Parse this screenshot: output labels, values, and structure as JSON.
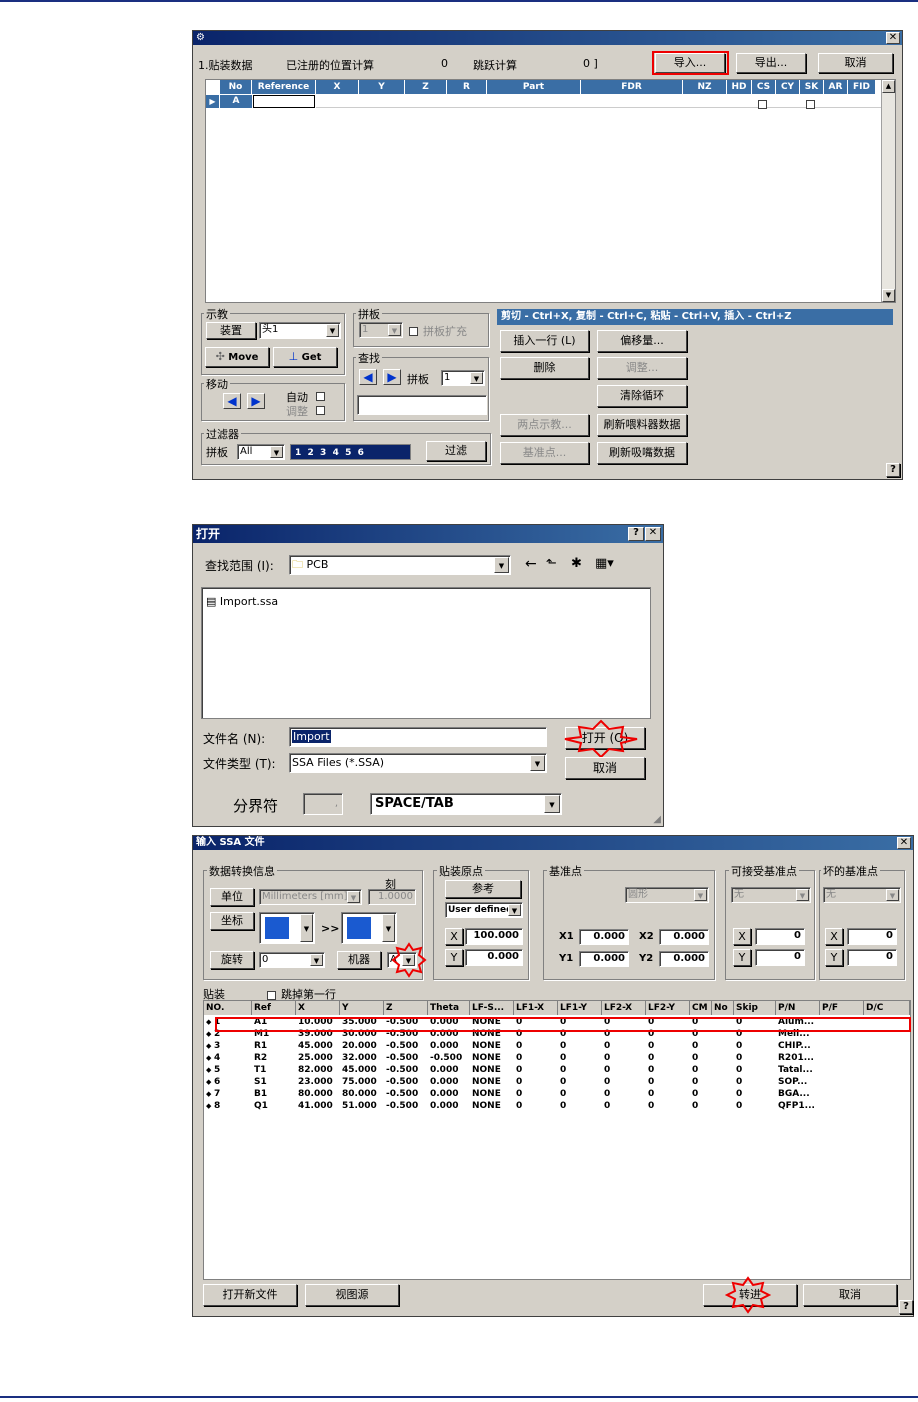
{
  "w1": {
    "title_icon": "app-icon",
    "info_label": "1.贴装数据",
    "registered_label": "已注册的位置计算",
    "registered_value": "0",
    "skip_label": "跳跃计算",
    "skip_value": "0 ]",
    "import_btn": "导入...",
    "export_btn": "导出...",
    "cancel_btn": "取消",
    "columns": [
      "No",
      "Reference",
      "X",
      "Y",
      "Z",
      "R",
      "Part",
      "FDR",
      "NZ",
      "HD",
      "CS",
      "CY",
      "SK",
      "AR",
      "FID"
    ],
    "row_no": "A",
    "teach_label": "示教",
    "mount_btn": "装置",
    "head_value": "头1",
    "move_btn": "Move",
    "get_btn": "Get",
    "move_label": "移动",
    "auto_label": "自动",
    "adjust_label": "调整",
    "panel_label": "拼板",
    "panel_value": "1",
    "panel_expand": "拼板扩充",
    "find_label": "查找",
    "find_panel_label": "拼板",
    "find_panel_value": "1",
    "filter_label": "过滤器",
    "filter_panel_label": "拼板",
    "filter_panel_value": "All",
    "filter_numbers": "1  2  3  4  5  6",
    "filter_btn": "过滤",
    "shortcut_text": "剪切 - Ctrl+X, 复制 - Ctrl+C, 粘贴 - Ctrl+V, 插入 - Ctrl+Z",
    "insert_row_btn": "插入一行 (L)",
    "offset_btn": "偏移量...",
    "delete_btn": "删除",
    "adjust_btn": "调整...",
    "clear_loop_btn": "清除循环",
    "two_point_btn": "两点示教...",
    "refresh_feeder_btn": "刷新喂料器数据",
    "fiducial_btn": "基准点...",
    "refresh_nozzle_btn": "刷新吸嘴数据",
    "help": "?"
  },
  "w2": {
    "title": "打开",
    "lookin_label": "查找范围 (I):",
    "lookin_value": "PCB",
    "file_item": "Import.ssa",
    "filename_label": "文件名 (N):",
    "filename_value": "Import",
    "filetype_label": "文件类型 (T):",
    "filetype_value": "SSA Files (*.SSA)",
    "open_btn": "打开 (O)",
    "cancel_btn": "取消",
    "separator_label": "分界符",
    "separator_value": ",",
    "delimiter_value": "SPACE/TAB"
  },
  "w3": {
    "title": "输入 SSA 文件",
    "conv_label": "数据转换信息",
    "unit_label": "单位",
    "unit_value": "Millimeters [mm]",
    "scale_label": "刻",
    "scale_value": "1.0000",
    "coord_label": "坐标",
    "rotate_label": "旋转",
    "rotate_value": "0",
    "machine_label": "机器",
    "machine_value": "A",
    "origin_label": "贴装原点",
    "ref_btn": "参考",
    "origin_mode": "User defined",
    "origin_x_label": "X",
    "origin_x": "100.000",
    "origin_y_label": "Y",
    "origin_y": "0.000",
    "fid_label": "基准点",
    "fid_shape": "圆形",
    "x1_label": "X1",
    "x1": "0.000",
    "x2_label": "X2",
    "x2": "0.000",
    "y1_label": "Y1",
    "y1": "0.000",
    "y2_label": "Y2",
    "y2": "0.000",
    "acc_fid_label": "可接受基准点",
    "acc_fid_value": "无",
    "acc_x_label": "X",
    "acc_x": "0",
    "acc_y_label": "Y",
    "acc_y": "0",
    "bad_fid_label": "坏的基准点",
    "bad_fid_value": "无",
    "bad_x_label": "X",
    "bad_x": "0",
    "bad_y_label": "Y",
    "bad_y": "0",
    "mount_label": "贴装",
    "skip_first_label": "跳掉第一行",
    "columns": [
      "NO.",
      "Ref",
      "X",
      "Y",
      "Z",
      "Theta",
      "LF-S...",
      "LF1-X",
      "LF1-Y",
      "LF2-X",
      "LF2-Y",
      "CM",
      "No",
      "Skip",
      "P/N",
      "P/F",
      "D/C"
    ],
    "rows": [
      [
        "1",
        "A1",
        "10.000",
        "35.000",
        "-0.500",
        "0.000",
        "NONE",
        "0",
        "0",
        "0",
        "0",
        "0",
        "0",
        "Alum..."
      ],
      [
        "2",
        "M1",
        "39.000",
        "30.000",
        "-0.500",
        "0.000",
        "NONE",
        "0",
        "0",
        "0",
        "0",
        "0",
        "0",
        "Mell..."
      ],
      [
        "3",
        "R1",
        "45.000",
        "20.000",
        "-0.500",
        "0.000",
        "NONE",
        "0",
        "0",
        "0",
        "0",
        "0",
        "0",
        "CHIP..."
      ],
      [
        "4",
        "R2",
        "25.000",
        "32.000",
        "-0.500",
        "-0.500",
        "NONE",
        "0",
        "0",
        "0",
        "0",
        "0",
        "0",
        "R201..."
      ],
      [
        "5",
        "T1",
        "82.000",
        "45.000",
        "-0.500",
        "0.000",
        "NONE",
        "0",
        "0",
        "0",
        "0",
        "0",
        "0",
        "Tatal..."
      ],
      [
        "6",
        "S1",
        "23.000",
        "75.000",
        "-0.500",
        "0.000",
        "NONE",
        "0",
        "0",
        "0",
        "0",
        "0",
        "0",
        "SOP..."
      ],
      [
        "7",
        "B1",
        "80.000",
        "80.000",
        "-0.500",
        "0.000",
        "NONE",
        "0",
        "0",
        "0",
        "0",
        "0",
        "0",
        "BGA..."
      ],
      [
        "8",
        "Q1",
        "41.000",
        "51.000",
        "-0.500",
        "0.000",
        "NONE",
        "0",
        "0",
        "0",
        "0",
        "0",
        "0",
        "QFP1..."
      ]
    ],
    "open_new_btn": "打开新文件",
    "view_source_btn": "视图源",
    "convert_btn": "转进",
    "cancel_btn": "取消",
    "help": "?"
  }
}
